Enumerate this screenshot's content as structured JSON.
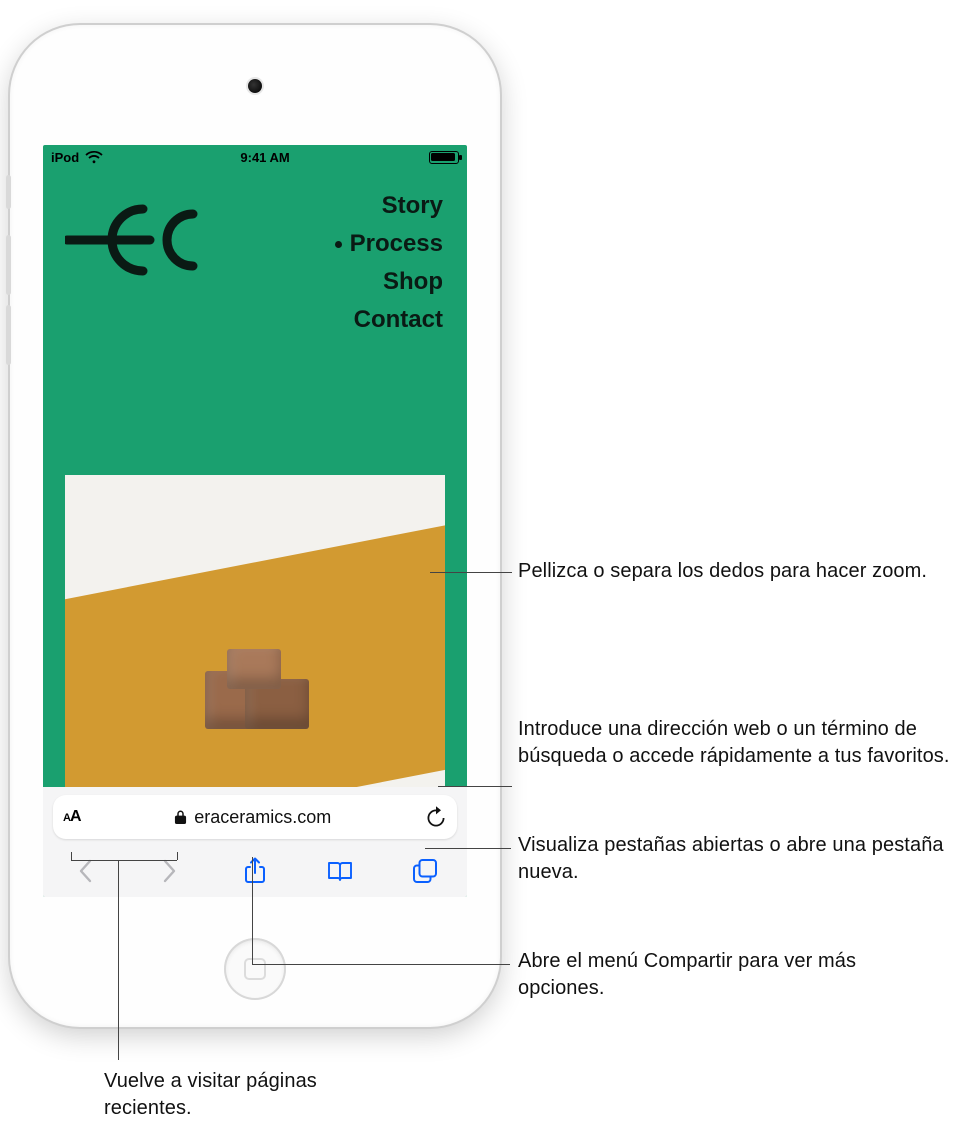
{
  "status_bar": {
    "carrier": "iPod",
    "time": "9:41 AM"
  },
  "webpage": {
    "nav": {
      "items": [
        "Story",
        "Process",
        "Shop",
        "Contact"
      ],
      "active_index": 1
    }
  },
  "url_bar": {
    "domain": "eraceramics.com"
  },
  "callouts": {
    "zoom": "Pellizca o separa los dedos para hacer zoom.",
    "urlbar": "Introduce una dirección web o un término de búsqueda o accede rápidamente a tus favoritos.",
    "tabs": "Visualiza pestañas abiertas o abre una pestaña nueva.",
    "share": "Abre el menú Compartir para ver más opciones.",
    "history": "Vuelve a visitar páginas recientes."
  }
}
